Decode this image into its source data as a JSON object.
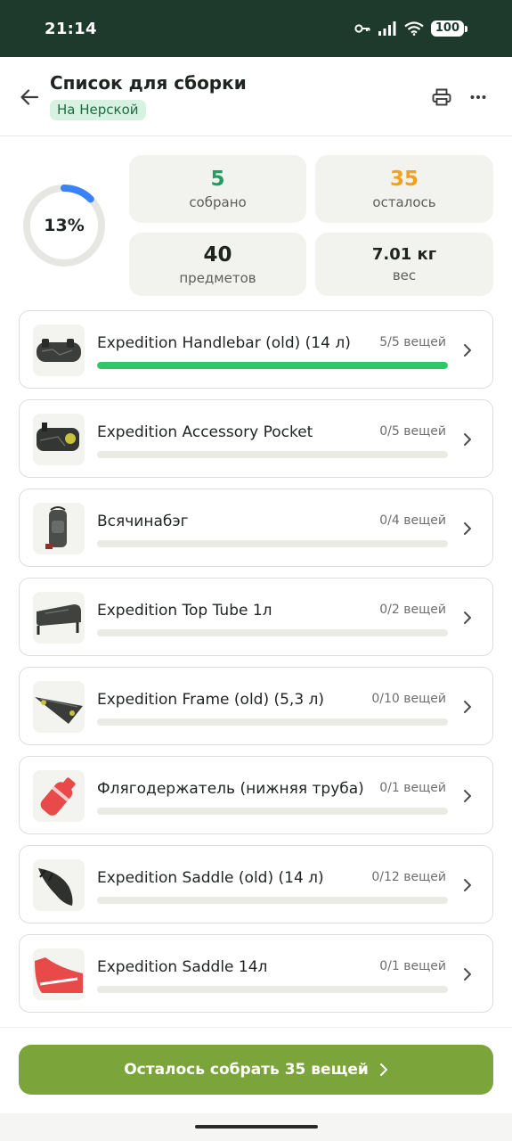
{
  "status_bar": {
    "time": "21:14",
    "battery": "100"
  },
  "header": {
    "title": "Список для сборки",
    "location": "На Нерской"
  },
  "summary": {
    "percent_label": "13%",
    "progress_fraction": 0.125,
    "collected_value": "5",
    "collected_label": "собрано",
    "remaining_value": "35",
    "remaining_label": "осталось",
    "total_value": "40",
    "total_label": "предметов",
    "weight_value": "7.01 кг",
    "weight_label": "вес"
  },
  "colors": {
    "accent_green": "#7ba53b",
    "collected": "#1f9d62",
    "remaining": "#f0a21c",
    "progress_bar": "#2ec866",
    "ring": "#3b82f6",
    "header": "#1d3a2c"
  },
  "bags": [
    {
      "name": "Expedition Handlebar (old) (14 л)",
      "count": "5/5 вещей",
      "progress": 1.0,
      "icon": "handlebar-bag-icon"
    },
    {
      "name": "Expedition Accessory Pocket",
      "count": "0/5 вещей",
      "progress": 0,
      "icon": "accessory-pocket-icon"
    },
    {
      "name": "Всячинабэг",
      "count": "0/4 вещей",
      "progress": 0,
      "icon": "backpack-icon"
    },
    {
      "name": "Expedition Top Tube 1л",
      "count": "0/2 вещей",
      "progress": 0,
      "icon": "top-tube-bag-icon"
    },
    {
      "name": "Expedition Frame (old) (5,3 л)",
      "count": "0/10 вещей",
      "progress": 0,
      "icon": "frame-bag-icon"
    },
    {
      "name": "Флягодержатель (нижняя труба)",
      "count": "0/1 вещей",
      "progress": 0,
      "icon": "bottle-icon"
    },
    {
      "name": "Expedition Saddle (old) (14 л)",
      "count": "0/12 вещей",
      "progress": 0,
      "icon": "saddle-bag-icon"
    },
    {
      "name": "Expedition Saddle 14л",
      "count": "0/1 вещей",
      "progress": 0,
      "icon": "saddle-bag-red-icon"
    }
  ],
  "cta": {
    "label": "Осталось собрать 35 вещей"
  }
}
